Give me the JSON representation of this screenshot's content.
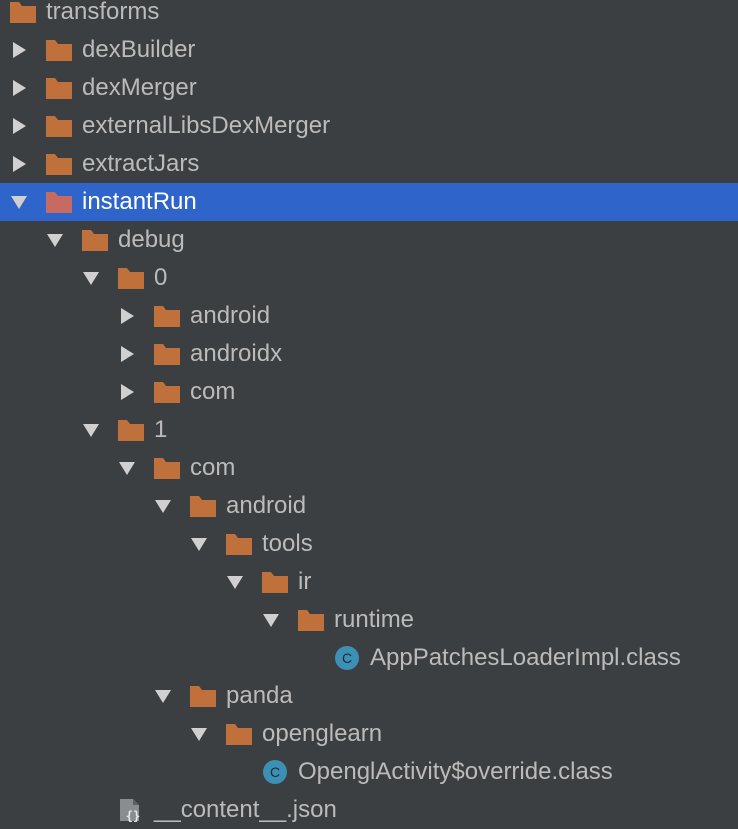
{
  "tree": {
    "colors": {
      "background": "#3c3f41",
      "selection": "#2f65ca",
      "folder": "#c0703a",
      "folder_selected": "#c66a62",
      "class_icon": "#3c8fb5",
      "text": "#bbbbbb",
      "arrow": "#d0d0d0"
    },
    "items": [
      {
        "label": "transforms",
        "depth": 0,
        "kind": "folder",
        "arrow": "none",
        "selected": false,
        "name": "tree-item-transforms"
      },
      {
        "label": "dexBuilder",
        "depth": 1,
        "kind": "folder",
        "arrow": "collapsed",
        "selected": false,
        "name": "tree-item-dexbuilder"
      },
      {
        "label": "dexMerger",
        "depth": 1,
        "kind": "folder",
        "arrow": "collapsed",
        "selected": false,
        "name": "tree-item-dexmerger"
      },
      {
        "label": "externalLibsDexMerger",
        "depth": 1,
        "kind": "folder",
        "arrow": "collapsed",
        "selected": false,
        "name": "tree-item-externallibsdexmerger"
      },
      {
        "label": "extractJars",
        "depth": 1,
        "kind": "folder",
        "arrow": "collapsed",
        "selected": false,
        "name": "tree-item-extractjars"
      },
      {
        "label": "instantRun",
        "depth": 1,
        "kind": "folder",
        "arrow": "expanded",
        "selected": true,
        "name": "tree-item-instantrun"
      },
      {
        "label": "debug",
        "depth": 2,
        "kind": "folder",
        "arrow": "expanded",
        "selected": false,
        "name": "tree-item-debug"
      },
      {
        "label": "0",
        "depth": 3,
        "kind": "folder",
        "arrow": "expanded",
        "selected": false,
        "name": "tree-item-0"
      },
      {
        "label": "android",
        "depth": 4,
        "kind": "folder",
        "arrow": "collapsed",
        "selected": false,
        "name": "tree-item-android"
      },
      {
        "label": "androidx",
        "depth": 4,
        "kind": "folder",
        "arrow": "collapsed",
        "selected": false,
        "name": "tree-item-androidx"
      },
      {
        "label": "com",
        "depth": 4,
        "kind": "folder",
        "arrow": "collapsed",
        "selected": false,
        "name": "tree-item-com"
      },
      {
        "label": "1",
        "depth": 3,
        "kind": "folder",
        "arrow": "expanded",
        "selected": false,
        "name": "tree-item-1"
      },
      {
        "label": "com",
        "depth": 4,
        "kind": "folder",
        "arrow": "expanded",
        "selected": false,
        "name": "tree-item-com-1"
      },
      {
        "label": "android",
        "depth": 5,
        "kind": "folder",
        "arrow": "expanded",
        "selected": false,
        "name": "tree-item-android-1"
      },
      {
        "label": "tools",
        "depth": 6,
        "kind": "folder",
        "arrow": "expanded",
        "selected": false,
        "name": "tree-item-tools"
      },
      {
        "label": "ir",
        "depth": 7,
        "kind": "folder",
        "arrow": "expanded",
        "selected": false,
        "name": "tree-item-ir"
      },
      {
        "label": "runtime",
        "depth": 8,
        "kind": "folder",
        "arrow": "expanded",
        "selected": false,
        "name": "tree-item-runtime"
      },
      {
        "label": "AppPatchesLoaderImpl.class",
        "depth": 9,
        "kind": "class",
        "arrow": "none",
        "selected": false,
        "name": "tree-item-apppatchesloaderimpl-class"
      },
      {
        "label": "panda",
        "depth": 5,
        "kind": "folder",
        "arrow": "expanded",
        "selected": false,
        "name": "tree-item-panda"
      },
      {
        "label": "openglearn",
        "depth": 6,
        "kind": "folder",
        "arrow": "expanded",
        "selected": false,
        "name": "tree-item-openglearn"
      },
      {
        "label": "OpenglActivity$override.class",
        "depth": 7,
        "kind": "class",
        "arrow": "none",
        "selected": false,
        "name": "tree-item-openglactivity-override-class"
      },
      {
        "label": "__content__.json",
        "depth": 3,
        "kind": "json",
        "arrow": "none",
        "selected": false,
        "name": "tree-item-content-json"
      }
    ]
  }
}
